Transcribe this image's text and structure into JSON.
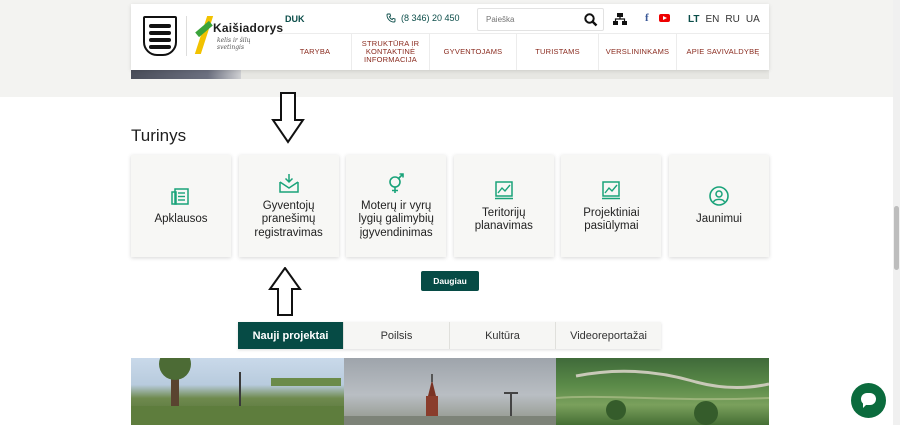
{
  "header": {
    "brand_name": "Kaišiadorys",
    "brand_tagline": "kelis ir šilų svetingis",
    "duk_link": "DUK",
    "phone": "(8 346) 20 450",
    "search_placeholder": "Paieška",
    "languages": [
      "LT",
      "EN",
      "RU",
      "UA"
    ],
    "active_language": "LT",
    "facebook_label": "f"
  },
  "nav": {
    "items": [
      {
        "label": "TARYBA"
      },
      {
        "label": "STRUKTŪRA IR KONTAKTINĖ INFORMACIJA"
      },
      {
        "label": "GYVENTOJAMS"
      },
      {
        "label": "TURISTAMS"
      },
      {
        "label": "VERSLININKAMS"
      },
      {
        "label": "APIE SAVIVALDYBĘ"
      }
    ]
  },
  "content": {
    "section_title": "Turinys",
    "cards": [
      {
        "label": "Apklausos",
        "icon": "survey-icon"
      },
      {
        "label": "Gyventojų pranešimų registravimas",
        "icon": "mail-inbox-icon"
      },
      {
        "label": "Moterų ir vyrų lygių galimybių įgyvendinimas",
        "icon": "gender-icon"
      },
      {
        "label": "Teritorijų planavimas",
        "icon": "map-plan-icon"
      },
      {
        "label": "Projektiniai pasiūlymai",
        "icon": "map-plan-icon"
      },
      {
        "label": "Jaunimui",
        "icon": "youth-icon"
      }
    ],
    "more_button": "Daugiau",
    "tabs": [
      {
        "label": "Nauji projektai",
        "active": true
      },
      {
        "label": "Poilsis",
        "active": false
      },
      {
        "label": "Kultūra",
        "active": false
      },
      {
        "label": "Videoreportažai",
        "active": false
      }
    ]
  },
  "colors": {
    "accent": "#064b45",
    "nav_text": "#8a2b1f",
    "icon_green": "#1aa37a",
    "chat": "#0b6b3d"
  }
}
